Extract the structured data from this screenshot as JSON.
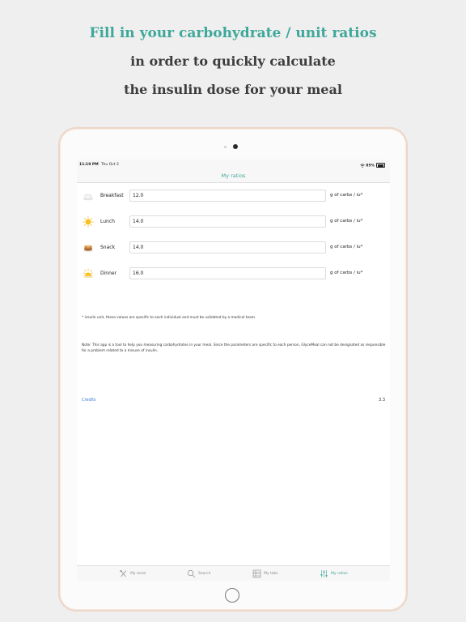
{
  "headline": {
    "line1": "Fill in your carbohydrate / unit ratios",
    "line2": "in order to quickly calculate",
    "line3": "the insulin dose for your meal"
  },
  "colors": {
    "accent": "#3fa89a",
    "link": "#3a7bd5",
    "frame": "#ecd6c9"
  },
  "status": {
    "time": "11:19 PM",
    "date": "Thu Oct 3",
    "battery": "85%"
  },
  "nav": {
    "title": "My ratios"
  },
  "ratios": [
    {
      "icon": "cup-icon",
      "label": "Breakfast",
      "value": "12.0",
      "unit": "g of carbs / iu*"
    },
    {
      "icon": "sun-icon",
      "label": "Lunch",
      "value": "14.0",
      "unit": "g of carbs / iu*"
    },
    {
      "icon": "pancakes-icon",
      "label": "Snack",
      "value": "14.0",
      "unit": "g of carbs / iu*"
    },
    {
      "icon": "sunset-icon",
      "label": "Dinner",
      "value": "16.0",
      "unit": "g of carbs / iu*"
    }
  ],
  "footnote": "* insulin unit, these values are specific to each individual and must be validated by a medical team.",
  "note": "Note: This app is a tool to help you measuring carbohydrates in your meal. Since the parameters are specific to each person, GlyceMeal can not be designated as responsible for a problem related to a misuse of insulin.",
  "credits": "Credits",
  "version": "3.3",
  "tabs": [
    {
      "icon": "fork-knife-icon",
      "label": "My meal",
      "active": false
    },
    {
      "icon": "search-icon",
      "label": "Search",
      "active": false
    },
    {
      "icon": "table-icon",
      "label": "My tabs",
      "active": false
    },
    {
      "icon": "sliders-icon",
      "label": "My ratios",
      "active": true
    }
  ]
}
